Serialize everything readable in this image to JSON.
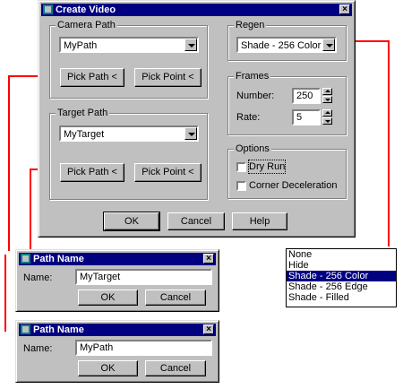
{
  "create_video": {
    "title": "Create Video",
    "camera_path": {
      "label": "Camera Path",
      "value": "MyPath",
      "pick_path": "Pick Path <",
      "pick_point": "Pick Point <"
    },
    "target_path": {
      "label": "Target Path",
      "value": "MyTarget",
      "pick_path": "Pick Path <",
      "pick_point": "Pick Point <"
    },
    "regen": {
      "label": "Regen",
      "value": "Shade - 256 Color"
    },
    "frames": {
      "label": "Frames",
      "number_label": "Number:",
      "number_value": "250",
      "rate_label": "Rate:",
      "rate_value": "5"
    },
    "options": {
      "label": "Options",
      "dry_run": "Dry Run",
      "corner_deceleration": "Corner Deceleration"
    },
    "buttons": {
      "ok": "OK",
      "cancel": "Cancel",
      "help": "Help"
    }
  },
  "regen_dropdown": {
    "items": [
      "None",
      "Hide",
      "Shade - 256 Color",
      "Shade - 256 Edge",
      "Shade - Filled"
    ],
    "selected_index": 2
  },
  "path_name_target": {
    "title": "Path Name",
    "name_label": "Name:",
    "name_value": "MyTarget",
    "ok": "OK",
    "cancel": "Cancel"
  },
  "path_name_camera": {
    "title": "Path Name",
    "name_label": "Name:",
    "name_value": "MyPath",
    "ok": "OK",
    "cancel": "Cancel"
  },
  "colors": {
    "connector": "#ff0000",
    "title_bar": "#000080",
    "dialog_face": "#c0c0c0"
  }
}
